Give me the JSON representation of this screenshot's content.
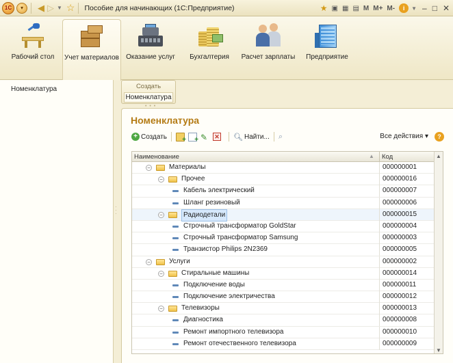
{
  "window": {
    "title": "Пособие для начинающих  (1С:Предприятие)",
    "logo": "1С",
    "right_tools": [
      "M",
      "M+",
      "M-"
    ]
  },
  "sections": [
    {
      "label": "Рабочий стол",
      "icon": "desk-icon"
    },
    {
      "label": "Учет материалов",
      "icon": "boxes-icon"
    },
    {
      "label": "Оказание услуг",
      "icon": "cash-register-icon"
    },
    {
      "label": "Бухгалтерия",
      "icon": "coins-icon"
    },
    {
      "label": "Расчет зарплаты",
      "icon": "people-icon"
    },
    {
      "label": "Предприятие",
      "icon": "building-icon"
    }
  ],
  "left_panel": {
    "items": [
      "Номенклатура"
    ]
  },
  "actions_panel": {
    "header": "Создать",
    "items": [
      "Номенклатура"
    ]
  },
  "form": {
    "title": "Номенклатура",
    "toolbar": {
      "create": "Создать",
      "find": "Найти...",
      "all_actions": "Все действия"
    },
    "columns": {
      "name": "Наименование",
      "code": "Код"
    },
    "rows": [
      {
        "level": 0,
        "type": "group",
        "expanded": true,
        "name": "Материалы",
        "code": "000000001"
      },
      {
        "level": 1,
        "type": "group",
        "expanded": true,
        "name": "Прочее",
        "code": "000000016"
      },
      {
        "level": 2,
        "type": "item",
        "name": "Кабель электрический",
        "code": "000000007"
      },
      {
        "level": 2,
        "type": "item",
        "name": "Шланг резиновый",
        "code": "000000006"
      },
      {
        "level": 1,
        "type": "group",
        "expanded": true,
        "name": "Радиодетали",
        "code": "000000015",
        "selected": true
      },
      {
        "level": 2,
        "type": "item",
        "name": "Строчный трансформатор GoldStar",
        "code": "000000004"
      },
      {
        "level": 2,
        "type": "item",
        "name": "Строчный трансформатор Samsung",
        "code": "000000003"
      },
      {
        "level": 2,
        "type": "item",
        "name": "Транзистор Philips 2N2369",
        "code": "000000005"
      },
      {
        "level": 0,
        "type": "group",
        "expanded": true,
        "name": "Услуги",
        "code": "000000002"
      },
      {
        "level": 1,
        "type": "group",
        "expanded": true,
        "name": "Стиральные машины",
        "code": "000000014"
      },
      {
        "level": 2,
        "type": "item",
        "name": "Подключение воды",
        "code": "000000011"
      },
      {
        "level": 2,
        "type": "item",
        "name": "Подключение электричества",
        "code": "000000012"
      },
      {
        "level": 1,
        "type": "group",
        "expanded": true,
        "name": "Телевизоры",
        "code": "000000013"
      },
      {
        "level": 2,
        "type": "item",
        "name": "Диагностика",
        "code": "000000008"
      },
      {
        "level": 2,
        "type": "item",
        "name": "Ремонт импортного телевизора",
        "code": "000000010"
      },
      {
        "level": 2,
        "type": "item",
        "name": "Ремонт отечественного телевизора",
        "code": "000000009"
      }
    ]
  },
  "colors": {
    "accent_title": "#b47b14",
    "selection": "#d6e8fb"
  }
}
